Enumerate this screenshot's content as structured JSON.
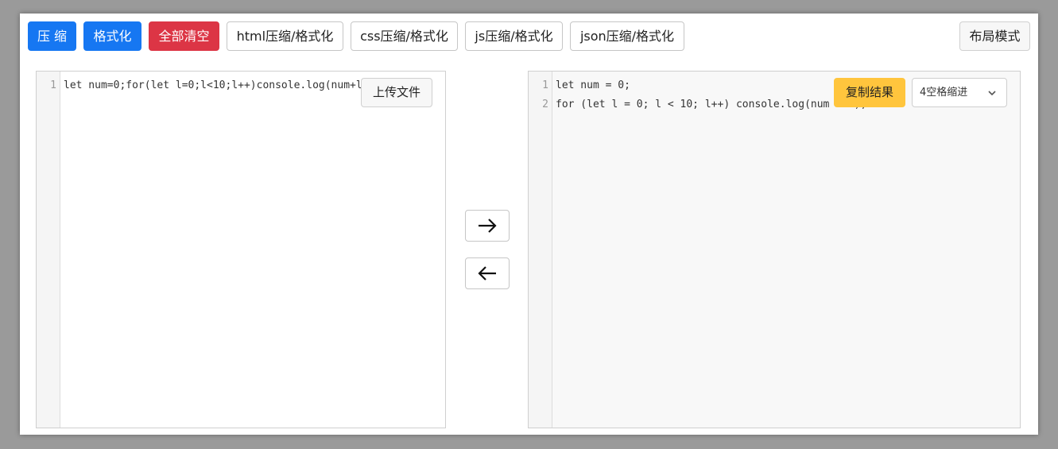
{
  "toolbar": {
    "compress_label": "压 缩",
    "format_label": "格式化",
    "clear_label": "全部清空",
    "html_label": "html压缩/格式化",
    "css_label": "css压缩/格式化",
    "js_label": "js压缩/格式化",
    "json_label": "json压缩/格式化",
    "layout_label": "布局模式"
  },
  "input_editor": {
    "upload_label": "上传文件",
    "lines": [
      {
        "num": "1",
        "text": "let num=0;for(let l=0;l<10;l++)console.log(num+l)"
      }
    ]
  },
  "output_editor": {
    "copy_label": "复制结果",
    "indent_selected": "4空格缩进",
    "lines": [
      {
        "num": "1",
        "text": "let num = 0;"
      },
      {
        "num": "2",
        "text": "for (let l = 0; l < 10; l++) console.log(num + l);"
      }
    ]
  },
  "icons": {
    "right": "arrow-right-icon",
    "left": "arrow-left-icon",
    "chevron": "chevron-down-icon"
  },
  "colors": {
    "primary": "#1677f2",
    "danger": "#dc3545",
    "warning": "#ffc53d"
  }
}
